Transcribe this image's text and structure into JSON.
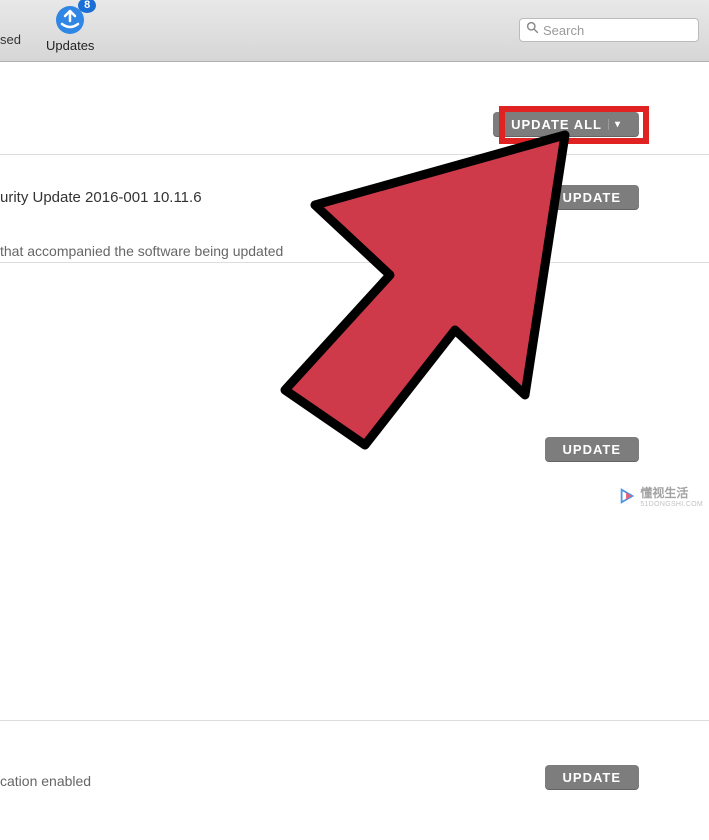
{
  "toolbar": {
    "tab_fragment": "sed",
    "updates": {
      "label": "Updates",
      "badge": "8"
    },
    "search": {
      "placeholder": "Search"
    }
  },
  "buttons": {
    "update_all": "UPDATE ALL",
    "update": "UPDATE"
  },
  "items": [
    {
      "title": "urity Update 2016-001 10.11.6",
      "desc": "that accompanied the software being updated"
    },
    {
      "title": "",
      "desc": ""
    },
    {
      "title": "",
      "desc": "cation enabled"
    }
  ],
  "watermark": {
    "text": "懂视生活",
    "sub": "51DONGSHI.COM"
  }
}
